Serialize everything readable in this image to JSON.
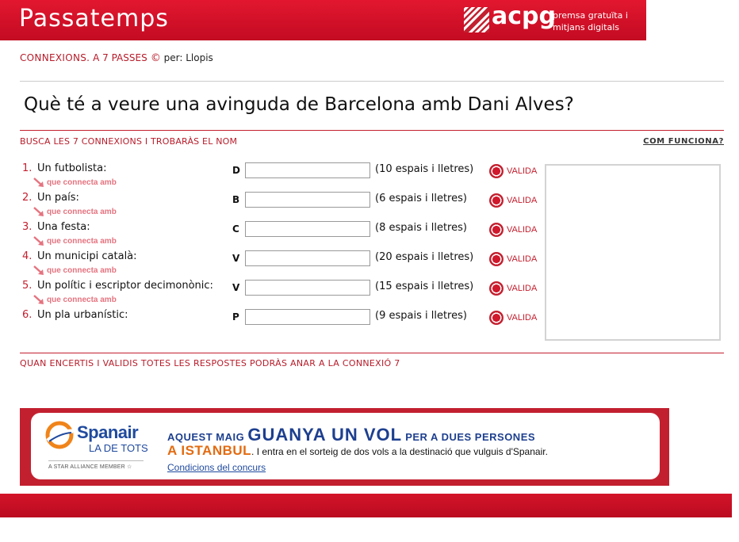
{
  "header": {
    "title": "Passatemps",
    "logo_word": "acpg",
    "logo_tagline_1": "premsa gratuïta i",
    "logo_tagline_2": "mitjans digitals",
    "logo_icon": "acpg-striped-square-icon"
  },
  "credit": {
    "game": "CONNEXIONS.",
    "steps": " A 7 PASSES",
    "copyright": "©",
    "author": " per: Llopis"
  },
  "question": "Què té a veure una avinguda de Barcelona amb Dani Alves?",
  "instructions": "BUSCA LES 7 CONNEXIONS I TROBARÀS EL NOM",
  "how_it_works": "COM FUNCIONA?",
  "connector_text": "que connecta amb",
  "validate_label": "VALIDA",
  "clues": [
    {
      "number": "1.",
      "label": "Un futbolista:",
      "letter": "D",
      "hint": "(10 espais i lletres)",
      "value": ""
    },
    {
      "number": "2.",
      "label": "Un país:",
      "letter": "B",
      "hint": "(6 espais i lletres)",
      "value": ""
    },
    {
      "number": "3.",
      "label": "Una festa:",
      "letter": "C",
      "hint": "(8 espais i lletres)",
      "value": ""
    },
    {
      "number": "4.",
      "label": "Un municipi català:",
      "letter": "V",
      "hint": "(20 espais i lletres)",
      "value": ""
    },
    {
      "number": "5.",
      "label": "Un polític i escriptor decimonònic:",
      "letter": "V",
      "hint": "(15 espais i lletres)",
      "value": ""
    },
    {
      "number": "6.",
      "label": "Un pla urbanístic:",
      "letter": "P",
      "hint": "(9 espais i lletres)",
      "value": ""
    }
  ],
  "footnote": "QUAN ENCERTIS I VALIDIS TOTES LES RESPOSTES PODRÀS ANAR A LA CONNEXIÓ 7",
  "ad": {
    "brand": "Spanair",
    "brand_sub": "LA DE TOTS",
    "alliance": "A STAR ALLIANCE MEMBER",
    "line1_a": "AQUEST MAIG ",
    "line1_b": "GUANYA UN VOL",
    "line1_c": " PER A DUES PERSONES",
    "line2_a": "A ISTANBUL",
    "line2_b": ". I entra en el sorteig de dos vols a la destinació que vulguis d'Spanair.",
    "link": "Condicions del concurs"
  },
  "colors": {
    "brand_red": "#c3202f",
    "label_red": "#b71c2a",
    "connector_pink": "#e5737f",
    "ad_blue": "#1f4a9e",
    "ad_orange": "#e36b11"
  }
}
